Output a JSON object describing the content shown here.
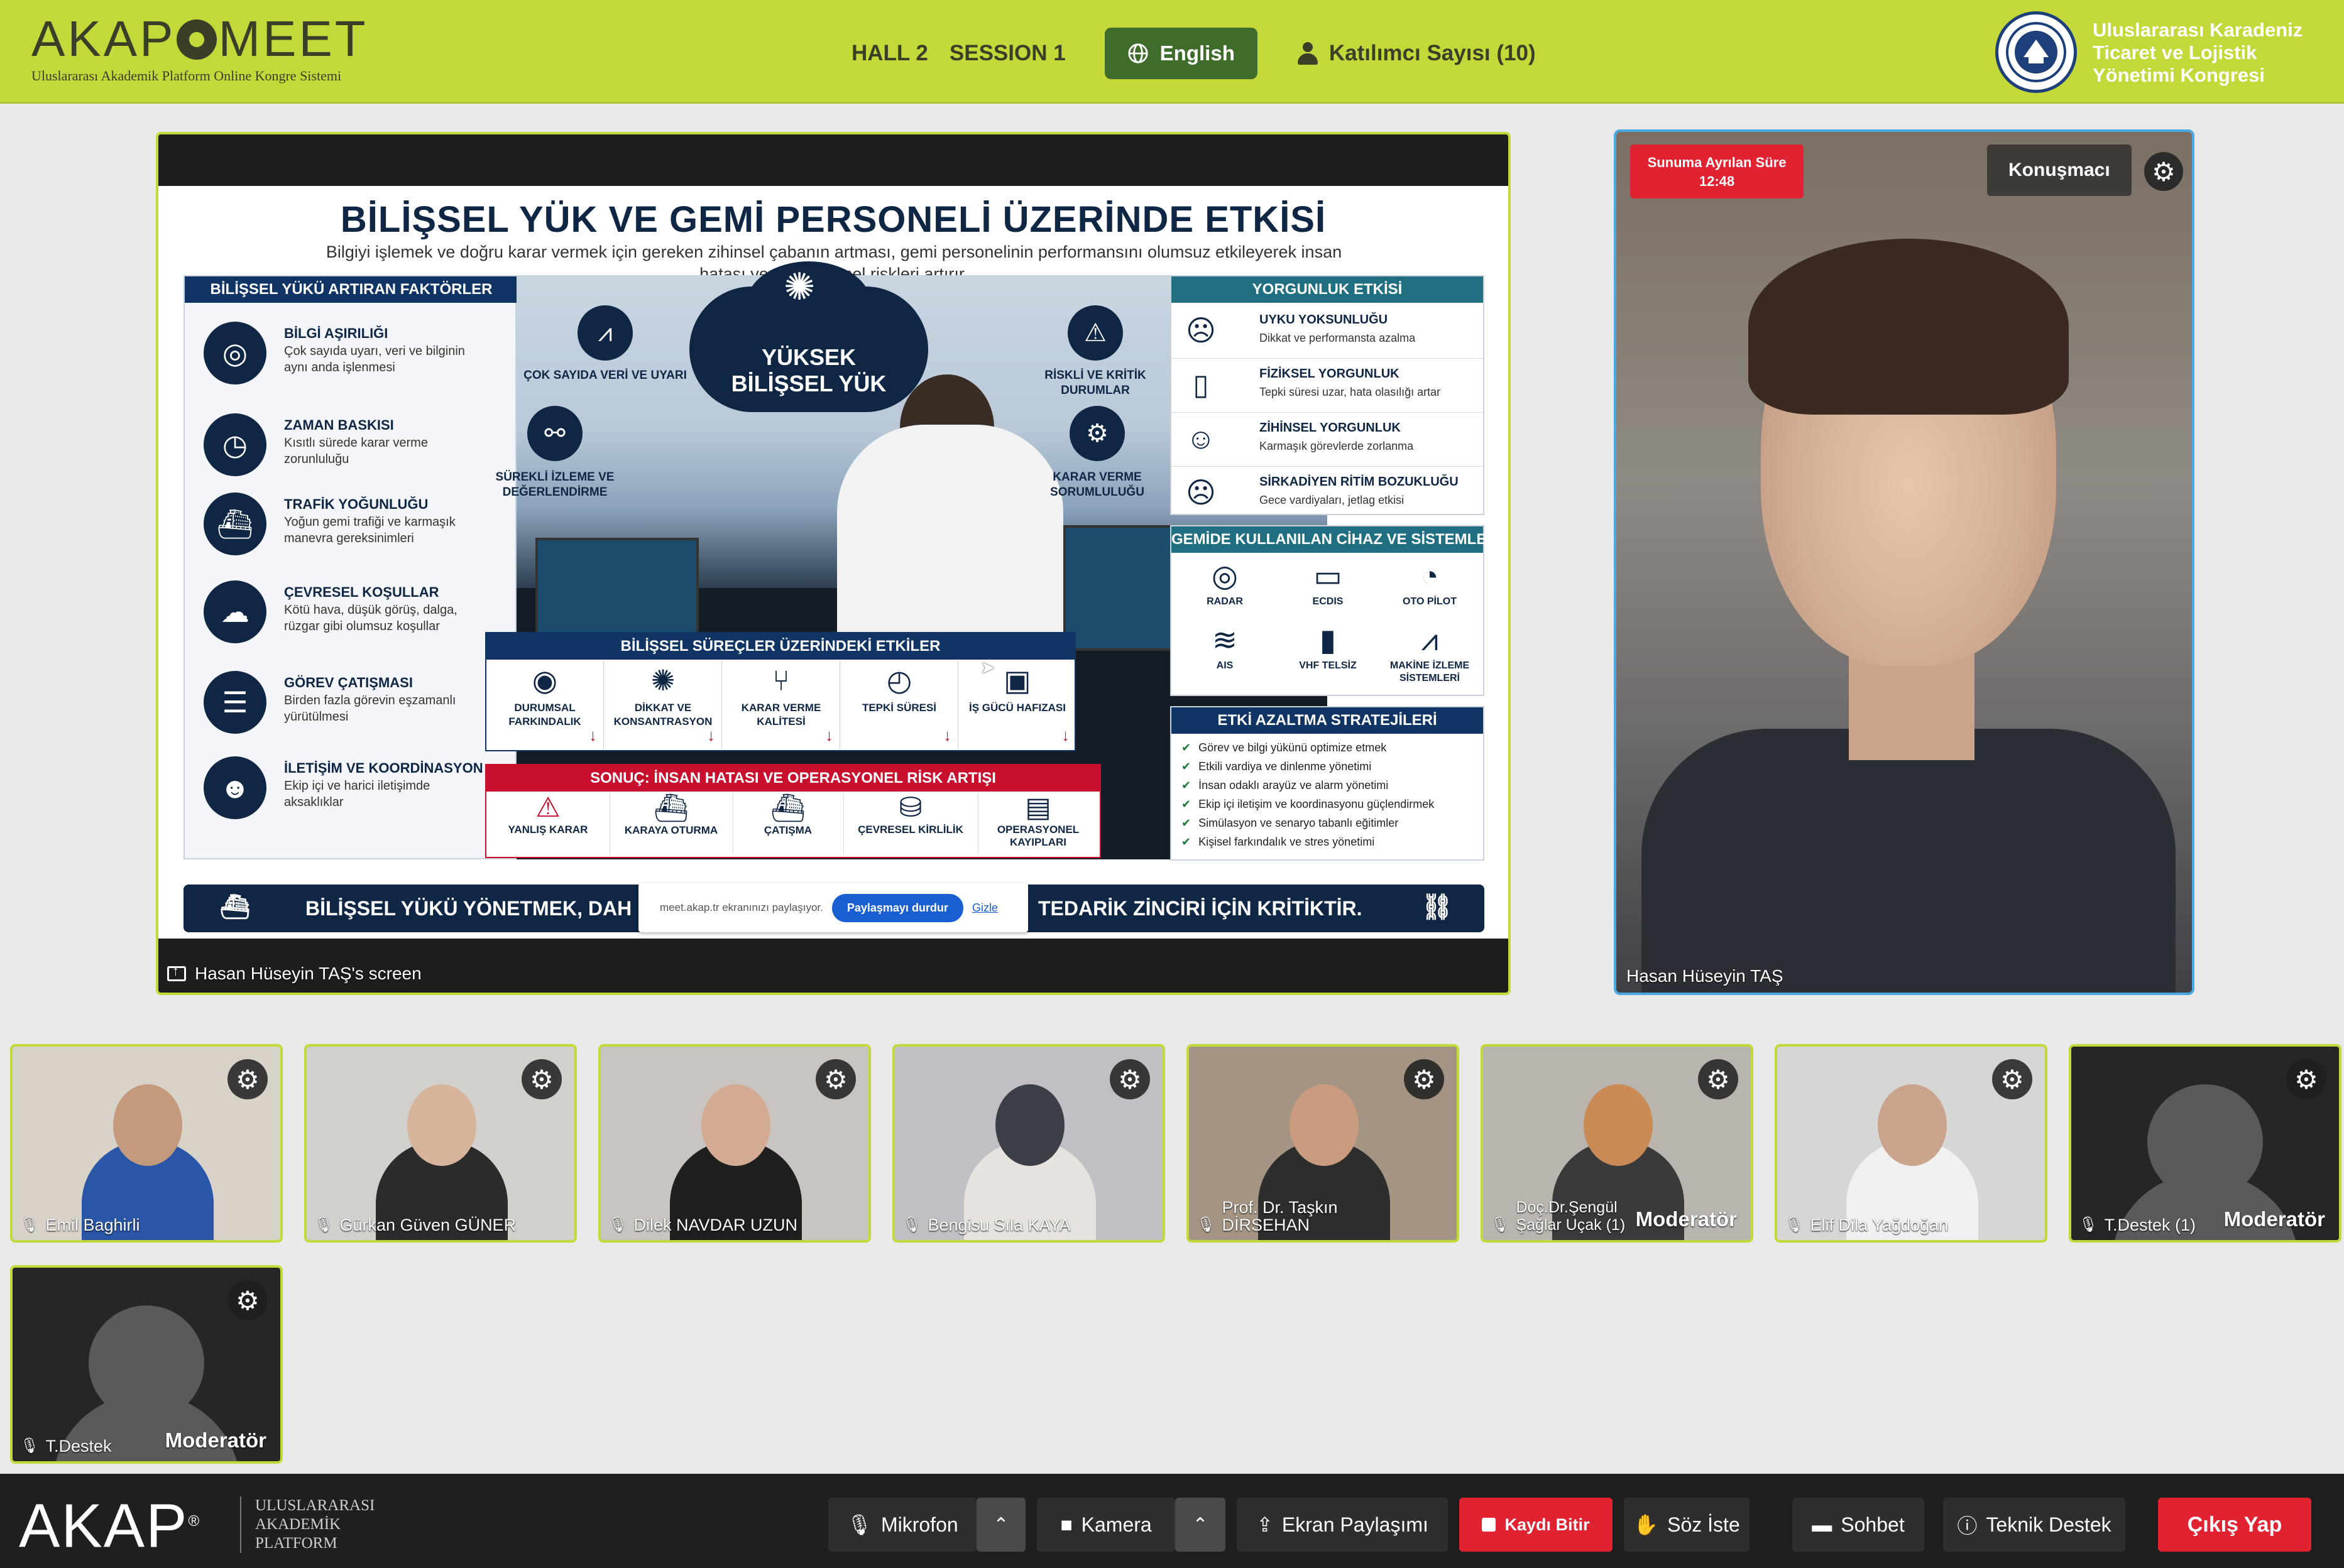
{
  "header": {
    "brand": "AKAPMEET",
    "brand_parts": {
      "left": "AKAP",
      "right": "MEET"
    },
    "brand_subtitle": "Uluslararası Akademik Platform Online Kongre Sistemi",
    "hall": "HALL 2",
    "session": "SESSION 1",
    "language_button": "English",
    "participants_label": "Katılımcı Sayısı (10)",
    "congress_name_lines": [
      "Uluslararası Karadeniz",
      "Ticaret ve Lojistik",
      "Yönetimi Kongresi"
    ]
  },
  "screen_share": {
    "caption": "Hasan Hüseyin TAŞ's screen",
    "slide": {
      "title": "BİLİŞSEL YÜK VE GEMİ PERSONELİ ÜZERİNDE ETKİSİ",
      "subtitle": "Bilgiyi işlemek ve doğru karar vermek için gereken zihinsel çabanın artması, gemi personelinin performansını olumsuz etkileyerek insan hatası ve operasyonel riskleri artırır.",
      "left_header": "BİLİŞSEL YÜKÜ ARTIRAN FAKTÖRLER",
      "factors": [
        {
          "title": "BİLGİ AŞIRILIĞI",
          "desc": "Çok sayıda uyarı, veri ve bilginin aynı anda işlenmesi",
          "icon": "radar-icon"
        },
        {
          "title": "ZAMAN BASKISI",
          "desc": "Kısıtlı sürede karar verme zorunluluğu",
          "icon": "clock-icon"
        },
        {
          "title": "TRAFİK YOĞUNLUĞU",
          "desc": "Yoğun gemi trafiği ve karmaşık manevra gereksinimleri",
          "icon": "ship-icon"
        },
        {
          "title": "ÇEVRESEL KOŞULLAR",
          "desc": "Kötü hava, düşük görüş, dalga, rüzgar gibi olumsuz koşullar",
          "icon": "storm-icon"
        },
        {
          "title": "GÖREV ÇATIŞMASI",
          "desc": "Birden fazla görevin eşzamanlı yürütülmesi",
          "icon": "checklist-icon"
        },
        {
          "title": "İLETİŞİM VE KOORDİNASYON",
          "desc": "Ekip içi ve harici iletişimde aksaklıklar",
          "icon": "team-icon"
        }
      ],
      "center_cloud": [
        "YÜKSEK",
        "BİLİŞSEL YÜK"
      ],
      "center_labels": {
        "data": "ÇOK SAYIDA VERİ VE UYARI",
        "risk": "RİSKLİ VE KRİTİK DURUMLAR",
        "monitor": "SÜREKLİ İZLEME VE DEĞERLENDİRME",
        "decision": "KARAR VERME SORUMLULUĞU"
      },
      "process_header": "BİLİŞSEL SÜREÇLER ÜZERİNDEKİ ETKİLER",
      "processes": [
        "DURUMSAL FARKINDALIK",
        "DİKKAT VE KONSANTRASYON",
        "KARAR VERME KALİTESİ",
        "TEPKİ SÜRESİ",
        "İŞ GÜCÜ HAFIZASI"
      ],
      "result_header": "SONUÇ: İNSAN HATASI VE OPERASYONEL RİSK ARTIŞI",
      "results": [
        "YANLIŞ KARAR",
        "KARAYA OTURMA",
        "ÇATIŞMA",
        "ÇEVRESEL KİRLİLİK",
        "OPERASYONEL KAYIPLARI"
      ],
      "fatigue_header": "YORGUNLUK ETKİSİ",
      "fatigue": [
        {
          "title": "UYKU YOKSUNLUĞU",
          "desc": "Dikkat ve performansta azalma"
        },
        {
          "title": "FİZİKSEL YORGUNLUK",
          "desc": "Tepki süresi uzar, hata olasılığı artar"
        },
        {
          "title": "ZİHİNSEL YORGUNLUK",
          "desc": "Karmaşık görevlerde zorlanma"
        },
        {
          "title": "SİRKADİYEN RİTİM BOZUKLUĞU",
          "desc": "Gece vardiyaları, jetlag etkisi"
        }
      ],
      "devices_header": "GEMİDE KULLANILAN CİHAZ VE SİSTEMLER",
      "devices": [
        "RADAR",
        "ECDIS",
        "OTO PİLOT",
        "AIS",
        "VHF TELSİZ",
        "MAKİNE İZLEME SİSTEMLERİ"
      ],
      "strategies_header": "ETKİ AZALTMA STRATEJİLERİ",
      "strategies": [
        "Görev ve bilgi yükünü optimize etmek",
        "Etkili vardiya ve dinlenme yönetimi",
        "İnsan odaklı arayüz ve alarm yönetimi",
        "Ekip içi iletişim ve koordinasyonu güçlendirmek",
        "Simülasyon ve senaryo tabanlı eğitimler",
        "Kişisel farkındalık ve stres yönetimi"
      ],
      "banner_left": "BİLİŞSEL YÜKÜ YÖNETMEK, DAH",
      "banner_right": "TEDARİK ZİNCİRİ İÇİN KRİTİKTİR."
    },
    "share_notice": {
      "text": "meet.akap.tr ekranınızı paylaşıyor.",
      "stop": "Paylaşmayı durdur",
      "hide": "Gizle"
    }
  },
  "speaker": {
    "timer_label": "Sunuma Ayrılan Süre",
    "timer_value": "12:48",
    "role": "Konuşmacı",
    "name": "Hasan Hüseyin TAŞ"
  },
  "participants": [
    {
      "name": "Emil Baghirli",
      "moderator": ""
    },
    {
      "name": "Gürkan Güven GÜNER",
      "moderator": ""
    },
    {
      "name": "Dilek NAVDAR UZUN",
      "moderator": ""
    },
    {
      "name": "Bengisu Sıla KAYA",
      "moderator": ""
    },
    {
      "name": "Prof. Dr. Taşkın DİRSEHAN",
      "moderator": ""
    },
    {
      "name": "Doç.Dr.Şengül Şağlar Uçak (1)",
      "moderator": "Moderatör"
    },
    {
      "name": "Elif Dila Yağdoğan",
      "moderator": ""
    },
    {
      "name": "T.Destek (1)",
      "moderator": "Moderatör"
    },
    {
      "name": "T.Destek",
      "moderator": "Moderatör"
    }
  ],
  "bottombar": {
    "logo": "AKAP",
    "logo_sub": [
      "ULUSLARARASI",
      "AKADEMİK",
      "PLATFORM"
    ],
    "mic": "Mikrofon",
    "camera": "Kamera",
    "screen_share": "Ekran Paylaşımı",
    "stop_recording": "Kaydı Bitir",
    "raise_hand": "Söz İste",
    "chat": "Sohbet",
    "support": "Teknik Destek",
    "exit": "Çıkış Yap"
  },
  "colors": {
    "header_bg": "#c5d83a",
    "accent_green": "#3f6b2b",
    "danger": "#e12230",
    "bottombar_bg": "#1f1f1f",
    "speaker_border": "#49a8e0"
  }
}
